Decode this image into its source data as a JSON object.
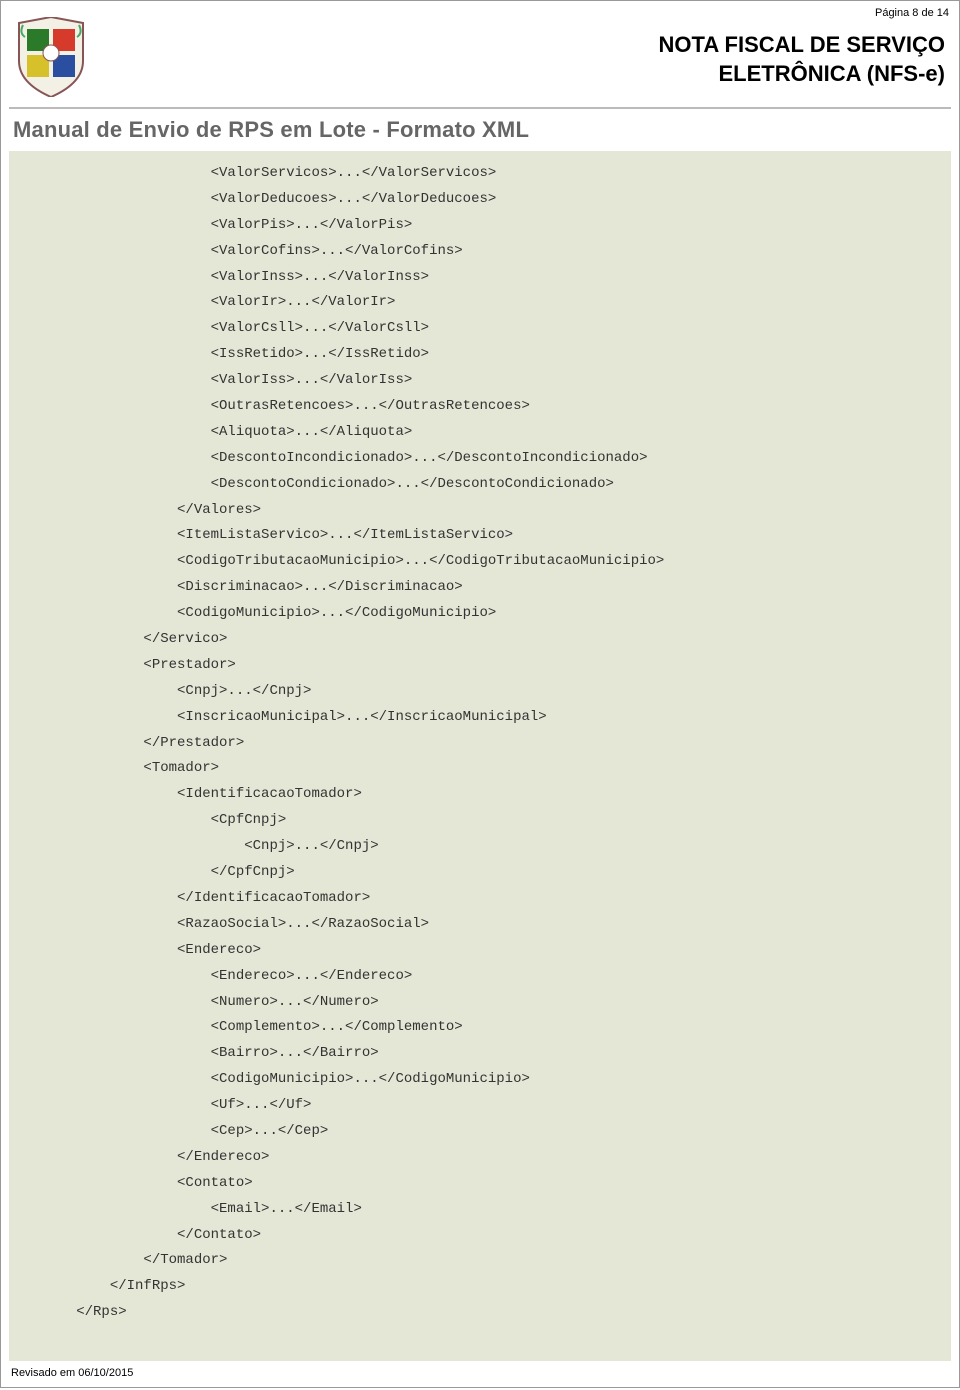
{
  "page_number": "Página 8 de 14",
  "header": {
    "title_line1": "NOTA FISCAL DE SERVIÇO",
    "title_line2": "ELETRÔNICA (NFS-e)"
  },
  "subtitle": "Manual de Envio de RPS em Lote - Formato XML",
  "code_lines": [
    {
      "indent": 6,
      "text": "<ValorServicos>...</ValorServicos>"
    },
    {
      "indent": 6,
      "text": "<ValorDeducoes>...</ValorDeducoes>"
    },
    {
      "indent": 6,
      "text": "<ValorPis>...</ValorPis>"
    },
    {
      "indent": 6,
      "text": "<ValorCofins>...</ValorCofins>"
    },
    {
      "indent": 6,
      "text": "<ValorInss>...</ValorInss>"
    },
    {
      "indent": 6,
      "text": "<ValorIr>...</ValorIr>"
    },
    {
      "indent": 6,
      "text": "<ValorCsll>...</ValorCsll>"
    },
    {
      "indent": 6,
      "text": "<IssRetido>...</IssRetido>"
    },
    {
      "indent": 6,
      "text": "<ValorIss>...</ValorIss>"
    },
    {
      "indent": 6,
      "text": "<OutrasRetencoes>...</OutrasRetencoes>"
    },
    {
      "indent": 6,
      "text": "<Aliquota>...</Aliquota>"
    },
    {
      "indent": 6,
      "text": "<DescontoIncondicionado>...</DescontoIncondicionado>"
    },
    {
      "indent": 6,
      "text": "<DescontoCondicionado>...</DescontoCondicionado>"
    },
    {
      "indent": 5,
      "text": "</Valores>"
    },
    {
      "indent": 5,
      "text": "<ItemListaServico>...</ItemListaServico>"
    },
    {
      "indent": 5,
      "text": "<CodigoTributacaoMunicipio>...</CodigoTributacaoMunicipio>"
    },
    {
      "indent": 5,
      "text": "<Discriminacao>...</Discriminacao>"
    },
    {
      "indent": 5,
      "text": "<CodigoMunicipio>...</CodigoMunicipio>"
    },
    {
      "indent": 4,
      "text": "</Servico>"
    },
    {
      "indent": 4,
      "text": "<Prestador>"
    },
    {
      "indent": 5,
      "text": "<Cnpj>...</Cnpj>"
    },
    {
      "indent": 5,
      "text": "<InscricaoMunicipal>...</InscricaoMunicipal>"
    },
    {
      "indent": 4,
      "text": "</Prestador>"
    },
    {
      "indent": 4,
      "text": "<Tomador>"
    },
    {
      "indent": 5,
      "text": "<IdentificacaoTomador>"
    },
    {
      "indent": 6,
      "text": "<CpfCnpj>"
    },
    {
      "indent": 7,
      "text": "<Cnpj>...</Cnpj>"
    },
    {
      "indent": 6,
      "text": "</CpfCnpj>"
    },
    {
      "indent": 5,
      "text": "</IdentificacaoTomador>"
    },
    {
      "indent": 5,
      "text": "<RazaoSocial>...</RazaoSocial>"
    },
    {
      "indent": 5,
      "text": "<Endereco>"
    },
    {
      "indent": 6,
      "text": "<Endereco>...</Endereco>"
    },
    {
      "indent": 6,
      "text": "<Numero>...</Numero>"
    },
    {
      "indent": 6,
      "text": "<Complemento>...</Complemento>"
    },
    {
      "indent": 6,
      "text": "<Bairro>...</Bairro>"
    },
    {
      "indent": 6,
      "text": "<CodigoMunicipio>...</CodigoMunicipio>"
    },
    {
      "indent": 6,
      "text": "<Uf>...</Uf>"
    },
    {
      "indent": 6,
      "text": "<Cep>...</Cep>"
    },
    {
      "indent": 5,
      "text": "</Endereco>"
    },
    {
      "indent": 5,
      "text": "<Contato>"
    },
    {
      "indent": 6,
      "text": "<Email>...</Email>"
    },
    {
      "indent": 5,
      "text": "</Contato>"
    },
    {
      "indent": 4,
      "text": "</Tomador>"
    },
    {
      "indent": 3,
      "text": "</InfRps>"
    },
    {
      "indent": 2,
      "text": "</Rps>"
    }
  ],
  "footer": "Revisado em 06/10/2015"
}
